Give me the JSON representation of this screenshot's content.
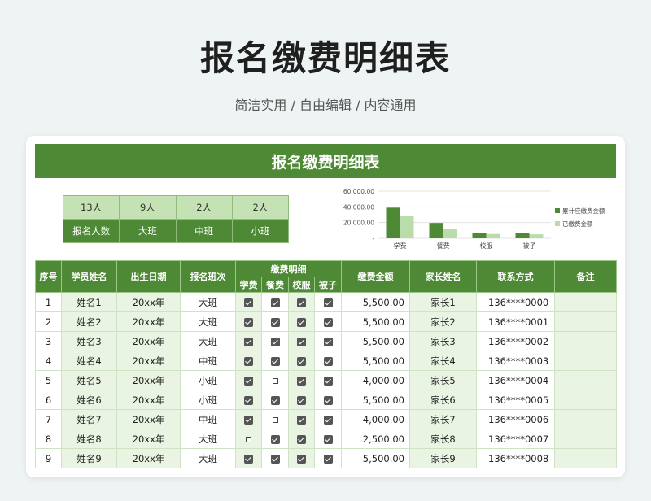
{
  "page": {
    "title": "报名缴费明细表",
    "subtitle": "简洁实用 / 自由编辑 / 内容通用"
  },
  "sheet": {
    "banner": "报名缴费明细表",
    "summary": {
      "counts": [
        "13人",
        "9人",
        "2人",
        "2人"
      ],
      "labels": [
        "报名人数",
        "大班",
        "中班",
        "小班"
      ]
    },
    "headers": {
      "index": "序号",
      "name": "学员姓名",
      "birth": "出生日期",
      "class": "报名班次",
      "fee_group": "缴费明细",
      "fee_items": [
        "学费",
        "餐费",
        "校服",
        "被子"
      ],
      "amount": "缴费金额",
      "parent": "家长姓名",
      "contact": "联系方式",
      "note": "备注"
    },
    "rows": [
      {
        "index": "1",
        "name": "姓名1",
        "birth": "20xx年",
        "class": "大班",
        "fees": [
          true,
          true,
          true,
          true
        ],
        "amount": "5,500.00",
        "parent": "家长1",
        "contact": "136****0000",
        "note": ""
      },
      {
        "index": "2",
        "name": "姓名2",
        "birth": "20xx年",
        "class": "大班",
        "fees": [
          true,
          true,
          true,
          true
        ],
        "amount": "5,500.00",
        "parent": "家长2",
        "contact": "136****0001",
        "note": ""
      },
      {
        "index": "3",
        "name": "姓名3",
        "birth": "20xx年",
        "class": "大班",
        "fees": [
          true,
          true,
          true,
          true
        ],
        "amount": "5,500.00",
        "parent": "家长3",
        "contact": "136****0002",
        "note": ""
      },
      {
        "index": "4",
        "name": "姓名4",
        "birth": "20xx年",
        "class": "中班",
        "fees": [
          true,
          true,
          true,
          true
        ],
        "amount": "5,500.00",
        "parent": "家长4",
        "contact": "136****0003",
        "note": ""
      },
      {
        "index": "5",
        "name": "姓名5",
        "birth": "20xx年",
        "class": "小班",
        "fees": [
          true,
          false,
          true,
          true
        ],
        "amount": "4,000.00",
        "parent": "家长5",
        "contact": "136****0004",
        "note": ""
      },
      {
        "index": "6",
        "name": "姓名6",
        "birth": "20xx年",
        "class": "小班",
        "fees": [
          true,
          true,
          true,
          true
        ],
        "amount": "5,500.00",
        "parent": "家长6",
        "contact": "136****0005",
        "note": ""
      },
      {
        "index": "7",
        "name": "姓名7",
        "birth": "20xx年",
        "class": "中班",
        "fees": [
          true,
          false,
          true,
          true
        ],
        "amount": "4,000.00",
        "parent": "家长7",
        "contact": "136****0006",
        "note": ""
      },
      {
        "index": "8",
        "name": "姓名8",
        "birth": "20xx年",
        "class": "大班",
        "fees": [
          false,
          true,
          true,
          true
        ],
        "amount": "2,500.00",
        "parent": "家长8",
        "contact": "136****0007",
        "note": ""
      },
      {
        "index": "9",
        "name": "姓名9",
        "birth": "20xx年",
        "class": "大班",
        "fees": [
          true,
          true,
          true,
          true
        ],
        "amount": "5,500.00",
        "parent": "家长9",
        "contact": "136****0008",
        "note": ""
      }
    ]
  },
  "chart_data": {
    "type": "bar",
    "categories": [
      "学费",
      "餐费",
      "校服",
      "被子"
    ],
    "series": [
      {
        "name": "累计应缴费金额",
        "values": [
          39000,
          19500,
          6500,
          6500
        ],
        "color": "#4e8a35"
      },
      {
        "name": "已缴费金额",
        "values": [
          29000,
          12000,
          5500,
          5000
        ],
        "color": "#b9dcaa"
      }
    ],
    "yticks": [
      "-",
      "20,000.00",
      "40,000.00",
      "60,000.00"
    ],
    "ylim": [
      0,
      60000
    ],
    "grid": true,
    "legend": "right"
  },
  "colors": {
    "accent": "#4e8a35",
    "light_accent": "#c5e2b4",
    "row_shade": "#eaf4e3"
  }
}
